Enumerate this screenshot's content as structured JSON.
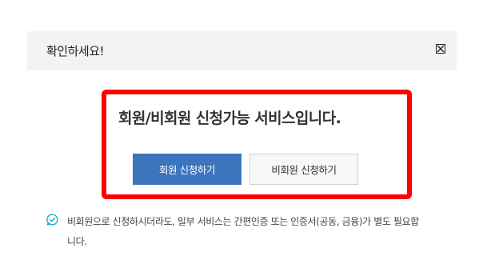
{
  "dialog": {
    "title": "확인하세요!",
    "close_icon": "close-box-icon"
  },
  "main": {
    "heading": "회원/비회원 신청가능 서비스입니다.",
    "member_button_label": "회원 신청하기",
    "nonmember_button_label": "비회원 신청하기"
  },
  "notice": {
    "icon": "chat-check-icon",
    "text": "비회원으로 신청하시더라도, 일부 서비스는 간편인증 또는 인증서(공동, 금융)가 별도 필요합니다."
  },
  "colors": {
    "primary_button": "#3d75bd",
    "highlight_border": "#ff0000",
    "notice_icon": "#1aa6c9"
  }
}
